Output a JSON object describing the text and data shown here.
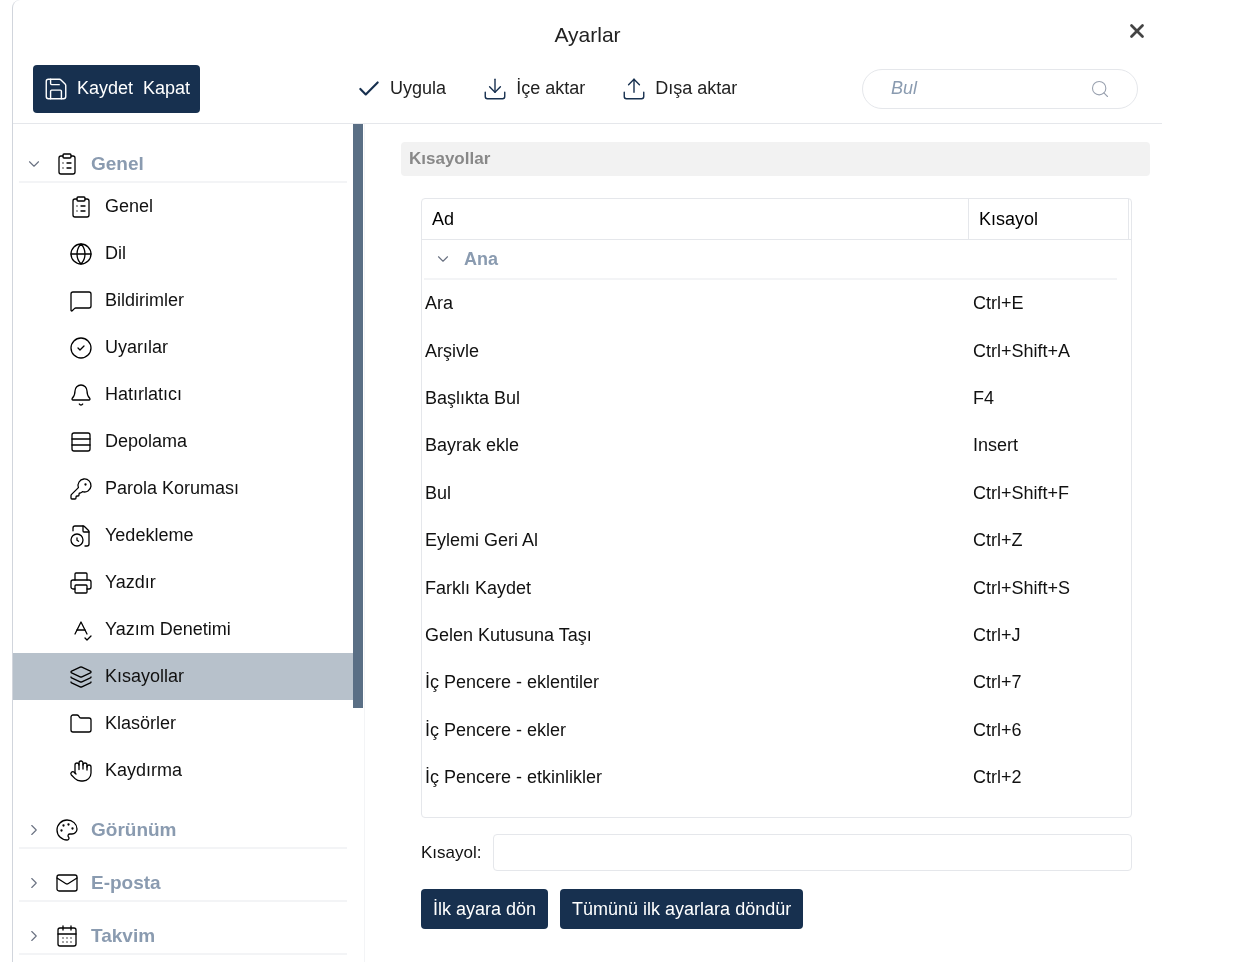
{
  "window": {
    "title": "Ayarlar"
  },
  "toolbar": {
    "save_close": "Kaydet  Kapat",
    "actions": [
      {
        "kind": "apply",
        "label": "Uygula"
      },
      {
        "kind": "import",
        "label": "İçe aktar"
      },
      {
        "kind": "export",
        "label": "Dışa aktar"
      }
    ],
    "search": {
      "placeholder": "Bul"
    }
  },
  "sidebar": {
    "groups": [
      {
        "label": "Genel",
        "expanded": true,
        "children": [
          {
            "label": "Genel",
            "selected": false
          },
          {
            "label": "Dil",
            "selected": false
          },
          {
            "label": "Bildirimler",
            "selected": false
          },
          {
            "label": "Uyarılar",
            "selected": false
          },
          {
            "label": "Hatırlatıcı",
            "selected": false
          },
          {
            "label": "Depolama",
            "selected": false
          },
          {
            "label": "Parola Koruması",
            "selected": false
          },
          {
            "label": "Yedekleme",
            "selected": false
          },
          {
            "label": "Yazdır",
            "selected": false
          },
          {
            "label": "Yazım Denetimi",
            "selected": false
          },
          {
            "label": "Kısayollar",
            "selected": true
          },
          {
            "label": "Klasörler",
            "selected": false
          },
          {
            "label": "Kaydırma",
            "selected": false
          }
        ]
      },
      {
        "label": "Görünüm",
        "expanded": false
      },
      {
        "label": "E-posta",
        "expanded": false
      },
      {
        "label": "Takvim",
        "expanded": false
      }
    ]
  },
  "section": {
    "title": "Kısayollar"
  },
  "table": {
    "columns": [
      "Ad",
      "Kısayol"
    ],
    "groups": [
      {
        "label": "Ana",
        "expanded": true,
        "rows": [
          [
            "Ara",
            "Ctrl+E"
          ],
          [
            "Arşivle",
            "Ctrl+Shift+A"
          ],
          [
            "Başlıkta Bul",
            "F4"
          ],
          [
            "Bayrak ekle",
            "Insert"
          ],
          [
            "Bul",
            "Ctrl+Shift+F"
          ],
          [
            "Eylemi Geri Al",
            "Ctrl+Z"
          ],
          [
            "Farklı Kaydet",
            "Ctrl+Shift+S"
          ],
          [
            "Gelen Kutusuna Taşı",
            "Ctrl+J"
          ],
          [
            "İç Pencere - eklentiler",
            "Ctrl+7"
          ],
          [
            "İç Pencere - ekler",
            "Ctrl+6"
          ],
          [
            "İç Pencere - etkinlikler",
            "Ctrl+2"
          ]
        ]
      }
    ]
  },
  "shortcut_field": {
    "label": "Kısayol:"
  },
  "buttons": [
    "İlk ayara dön",
    "Tümünü ilk ayarlara döndür"
  ]
}
